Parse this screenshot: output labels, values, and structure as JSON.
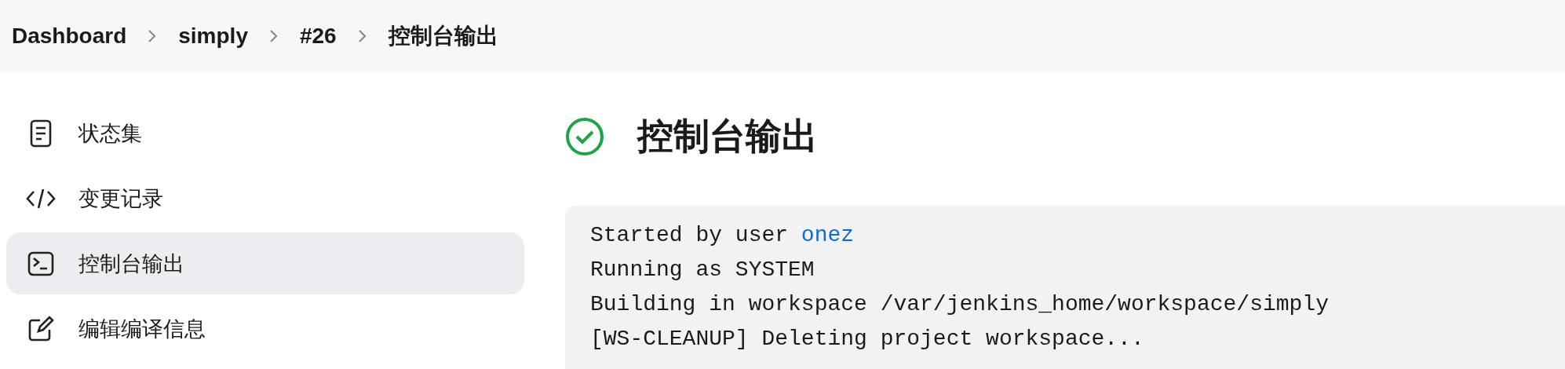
{
  "breadcrumbs": [
    "Dashboard",
    "simply",
    "#26",
    "控制台输出"
  ],
  "sidebar": {
    "items": [
      {
        "label": "状态集",
        "kind": "document",
        "selected": false
      },
      {
        "label": "变更记录",
        "kind": "code",
        "selected": false
      },
      {
        "label": "控制台输出",
        "kind": "terminal",
        "selected": true
      },
      {
        "label": "编辑编译信息",
        "kind": "edit",
        "selected": false
      }
    ]
  },
  "main": {
    "title": "控制台输出",
    "kind": "success",
    "console": [
      {
        "text": "Started by user ",
        "link": "onez"
      },
      {
        "text": "Running as SYSTEM"
      },
      {
        "text": "Building in workspace /var/jenkins_home/workspace/simply"
      },
      {
        "text": "[WS-CLEANUP] Deleting project workspace..."
      }
    ]
  }
}
